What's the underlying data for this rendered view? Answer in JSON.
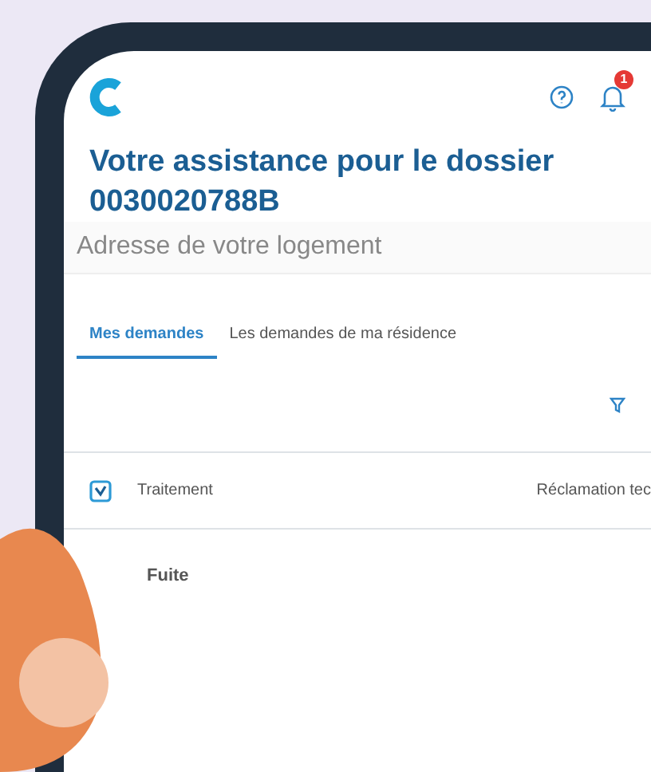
{
  "header": {
    "notification_count": "1"
  },
  "title": "Votre assistance pour le dossier",
  "dossier_number": "0030020788B",
  "address": "Adresse de votre logement",
  "tabs": [
    {
      "label": "Mes demandes",
      "selected": true
    },
    {
      "label": "Les demandes de ma résidence",
      "selected": false
    }
  ],
  "requests": [
    {
      "status": "Traitement",
      "category": "Réclamation tec",
      "title": "Fuite"
    }
  ]
}
